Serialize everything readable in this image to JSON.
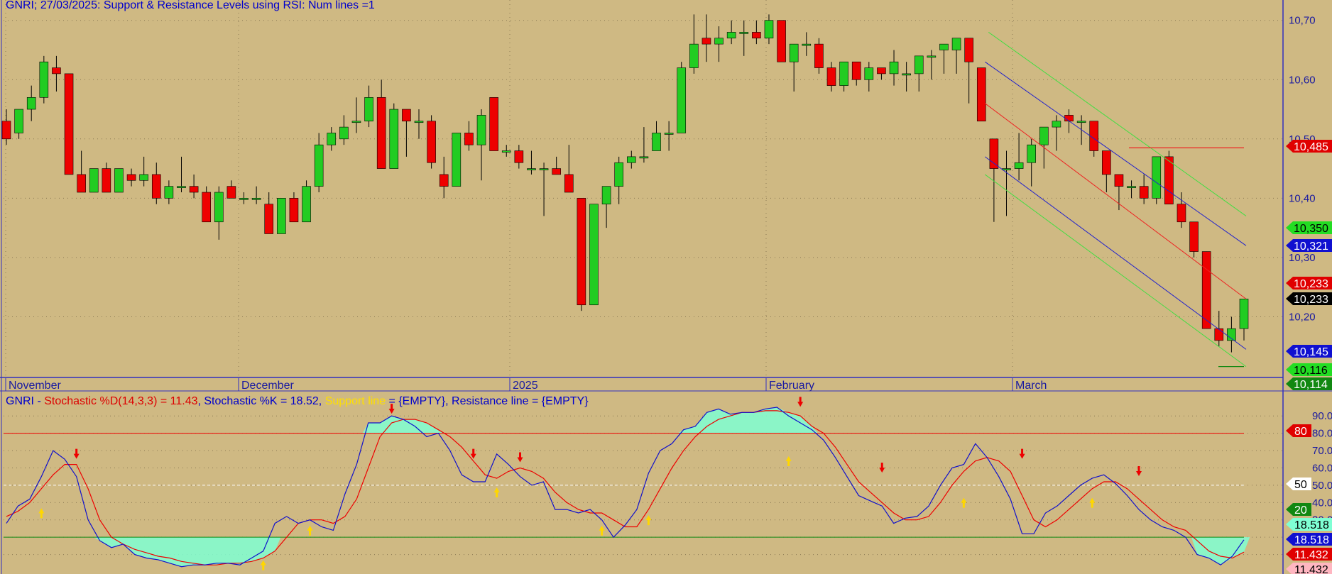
{
  "upper": {
    "title": "GNRI; 27/03/2025: Support & Resistance Levels using RSI: Num lines =1",
    "months": [
      "November",
      "December",
      "2025",
      "February",
      "March"
    ],
    "axis_ticks": [
      "10,70",
      "10,60",
      "10,50",
      "10,40",
      "10,30",
      "10,20"
    ],
    "tags": [
      {
        "text": "10,485",
        "color": "#E00000",
        "text_color": "#FFFFFF",
        "value": 10.485
      },
      {
        "text": "10,350",
        "color": "#22DD22",
        "text_color": "#000000",
        "value": 10.35
      },
      {
        "text": "10,321",
        "color": "#1010D0",
        "text_color": "#FFFFFF",
        "value": 10.321
      },
      {
        "text": "10,233",
        "color": "#E00000",
        "text_color": "#FFFFFF",
        "value": 10.233
      },
      {
        "text": "10,233",
        "color": "#000000",
        "text_color": "#FFFFFF",
        "value": 10.233
      },
      {
        "text": "10,145",
        "color": "#1010D0",
        "text_color": "#FFFFFF",
        "value": 10.145
      },
      {
        "text": "10,116",
        "color": "#22DD22",
        "text_color": "#000000",
        "value": 10.116
      },
      {
        "text": "10,114",
        "color": "#118811",
        "text_color": "#FFFFFF",
        "value": 10.114
      }
    ]
  },
  "lower": {
    "title_parts": [
      {
        "text": "GNRI - ",
        "color": "#0000CC"
      },
      {
        "text": "Stochastic %D(14,3,3) = 11.43",
        "color": "#DD0000"
      },
      {
        "text": ", Stochastic %K = 18.52, ",
        "color": "#0000CC"
      },
      {
        "text": "Support line",
        "color": "#FFE000"
      },
      {
        "text": " = {EMPTY}, Resistance line = {EMPTY}",
        "color": "#0000CC"
      }
    ],
    "axis_ticks": [
      "90.0",
      "80.0",
      "70.0",
      "60.0",
      "50.0",
      "40.0",
      "30.0"
    ],
    "tags": [
      {
        "text": "80",
        "color": "#E00000",
        "text_color": "#FFFFFF",
        "value": 80
      },
      {
        "text": "50",
        "color": "#FFFFFF",
        "text_color": "#000000",
        "value": 50
      },
      {
        "text": "20",
        "color": "#118811",
        "text_color": "#FFFFFF",
        "value": 20
      },
      {
        "text": "18.518",
        "color": "#7FFFD4",
        "text_color": "#000000",
        "value": 18.518
      },
      {
        "text": "18.518",
        "color": "#1010D0",
        "text_color": "#FFFFFF",
        "value": 18.518
      },
      {
        "text": "11.432",
        "color": "#E00000",
        "text_color": "#FFFFFF",
        "value": 11.432
      },
      {
        "text": "11.432",
        "color": "#FFB6C1",
        "text_color": "#000000",
        "value": 11.432
      }
    ]
  },
  "chart_data": [
    {
      "type": "candlestick",
      "title": "GNRI; 27/03/2025: Support & Resistance Levels using RSI: Num lines =1",
      "ylim": [
        10.1,
        10.72
      ],
      "x_labels": [
        "November",
        "December",
        "2025",
        "February",
        "March"
      ],
      "up_color": "#22CC22",
      "down_color": "#EE0000",
      "candles": [
        [
          10.53,
          10.55,
          10.49,
          10.5
        ],
        [
          10.51,
          10.55,
          10.5,
          10.55
        ],
        [
          10.55,
          10.59,
          10.53,
          10.57
        ],
        [
          10.57,
          10.64,
          10.56,
          10.63
        ],
        [
          10.62,
          10.64,
          10.58,
          10.61
        ],
        [
          10.61,
          10.61,
          10.44,
          10.44
        ],
        [
          10.44,
          10.48,
          10.41,
          10.41
        ],
        [
          10.41,
          10.45,
          10.41,
          10.45
        ],
        [
          10.45,
          10.46,
          10.41,
          10.41
        ],
        [
          10.41,
          10.45,
          10.41,
          10.45
        ],
        [
          10.44,
          10.45,
          10.42,
          10.43
        ],
        [
          10.43,
          10.47,
          10.42,
          10.44
        ],
        [
          10.44,
          10.46,
          10.39,
          10.4
        ],
        [
          10.4,
          10.43,
          10.39,
          10.42
        ],
        [
          10.42,
          10.47,
          10.41,
          10.42
        ],
        [
          10.42,
          10.44,
          10.4,
          10.41
        ],
        [
          10.41,
          10.42,
          10.36,
          10.36
        ],
        [
          10.36,
          10.42,
          10.33,
          10.41
        ],
        [
          10.42,
          10.43,
          10.4,
          10.4
        ],
        [
          10.4,
          10.41,
          10.39,
          10.4
        ],
        [
          10.4,
          10.42,
          10.39,
          10.4
        ],
        [
          10.39,
          10.41,
          10.34,
          10.34
        ],
        [
          10.34,
          10.4,
          10.34,
          10.4
        ],
        [
          10.4,
          10.41,
          10.36,
          10.36
        ],
        [
          10.36,
          10.43,
          10.36,
          10.42
        ],
        [
          10.42,
          10.51,
          10.41,
          10.49
        ],
        [
          10.49,
          10.52,
          10.48,
          10.51
        ],
        [
          10.5,
          10.54,
          10.49,
          10.52
        ],
        [
          10.53,
          10.57,
          10.51,
          10.53
        ],
        [
          10.53,
          10.59,
          10.52,
          10.57
        ],
        [
          10.57,
          10.6,
          10.45,
          10.45
        ],
        [
          10.45,
          10.56,
          10.45,
          10.55
        ],
        [
          10.55,
          10.55,
          10.47,
          10.53
        ],
        [
          10.53,
          10.55,
          10.5,
          10.53
        ],
        [
          10.53,
          10.54,
          10.45,
          10.46
        ],
        [
          10.44,
          10.47,
          10.4,
          10.42
        ],
        [
          10.42,
          10.51,
          10.42,
          10.51
        ],
        [
          10.51,
          10.53,
          10.48,
          10.49
        ],
        [
          10.49,
          10.55,
          10.43,
          10.54
        ],
        [
          10.57,
          10.57,
          10.48,
          10.48
        ],
        [
          10.48,
          10.49,
          10.47,
          10.48
        ],
        [
          10.48,
          10.49,
          10.45,
          10.46
        ],
        [
          10.45,
          10.48,
          10.44,
          10.45
        ],
        [
          10.45,
          10.46,
          10.37,
          10.45
        ],
        [
          10.45,
          10.47,
          10.44,
          10.44
        ],
        [
          10.44,
          10.49,
          10.41,
          10.41
        ],
        [
          10.4,
          10.4,
          10.21,
          10.22
        ],
        [
          10.22,
          10.39,
          10.22,
          10.39
        ],
        [
          10.39,
          10.42,
          10.35,
          10.42
        ],
        [
          10.42,
          10.47,
          10.39,
          10.46
        ],
        [
          10.46,
          10.48,
          10.45,
          10.47
        ],
        [
          10.47,
          10.52,
          10.46,
          10.47
        ],
        [
          10.48,
          10.53,
          10.48,
          10.51
        ],
        [
          10.51,
          10.53,
          10.48,
          10.51
        ],
        [
          10.51,
          10.63,
          10.51,
          10.62
        ],
        [
          10.62,
          10.71,
          10.61,
          10.66
        ],
        [
          10.67,
          10.71,
          10.63,
          10.66
        ],
        [
          10.66,
          10.69,
          10.63,
          10.67
        ],
        [
          10.67,
          10.7,
          10.66,
          10.68
        ],
        [
          10.68,
          10.7,
          10.64,
          10.68
        ],
        [
          10.68,
          10.7,
          10.66,
          10.67
        ],
        [
          10.67,
          10.71,
          10.66,
          10.7
        ],
        [
          10.7,
          10.7,
          10.63,
          10.63
        ],
        [
          10.63,
          10.66,
          10.58,
          10.66
        ],
        [
          10.66,
          10.68,
          10.64,
          10.66
        ],
        [
          10.66,
          10.67,
          10.61,
          10.62
        ],
        [
          10.62,
          10.63,
          10.58,
          10.59
        ],
        [
          10.59,
          10.63,
          10.58,
          10.63
        ],
        [
          10.63,
          10.63,
          10.59,
          10.6
        ],
        [
          10.6,
          10.63,
          10.58,
          10.62
        ],
        [
          10.62,
          10.62,
          10.6,
          10.61
        ],
        [
          10.61,
          10.65,
          10.59,
          10.63
        ],
        [
          10.61,
          10.63,
          10.58,
          10.61
        ],
        [
          10.61,
          10.64,
          10.58,
          10.64
        ],
        [
          10.64,
          10.65,
          10.6,
          10.64
        ],
        [
          10.65,
          10.66,
          10.61,
          10.66
        ],
        [
          10.65,
          10.67,
          10.61,
          10.67
        ],
        [
          10.67,
          10.67,
          10.56,
          10.63
        ],
        [
          10.62,
          10.62,
          10.53,
          10.53
        ],
        [
          10.5,
          10.5,
          10.36,
          10.45
        ],
        [
          10.45,
          10.48,
          10.37,
          10.45
        ],
        [
          10.45,
          10.51,
          10.43,
          10.46
        ],
        [
          10.46,
          10.5,
          10.42,
          10.49
        ],
        [
          10.49,
          10.5,
          10.45,
          10.52
        ],
        [
          10.52,
          10.54,
          10.48,
          10.53
        ],
        [
          10.54,
          10.55,
          10.51,
          10.53
        ],
        [
          10.53,
          10.54,
          10.49,
          10.53
        ],
        [
          10.53,
          10.53,
          10.47,
          10.48
        ],
        [
          10.48,
          10.48,
          10.41,
          10.44
        ],
        [
          10.44,
          10.44,
          10.38,
          10.42
        ],
        [
          10.42,
          10.43,
          10.4,
          10.42
        ],
        [
          10.42,
          10.44,
          10.39,
          10.4
        ],
        [
          10.4,
          10.47,
          10.39,
          10.47
        ],
        [
          10.47,
          10.48,
          10.39,
          10.39
        ],
        [
          10.39,
          10.41,
          10.35,
          10.36
        ],
        [
          10.36,
          10.36,
          10.3,
          10.31
        ],
        [
          10.31,
          10.31,
          10.18,
          10.18
        ],
        [
          10.18,
          10.21,
          10.15,
          10.16
        ],
        [
          10.16,
          10.2,
          10.14,
          10.18
        ],
        [
          10.18,
          10.23,
          10.16,
          10.23
        ]
      ]
    },
    {
      "type": "line",
      "title": "Stochastic %D(14,3,3) = 11.43, Stochastic %K = 18.52",
      "ylim": [
        0,
        95
      ],
      "series": [
        {
          "name": "Stochastic %K",
          "color": "#1010CC",
          "values": [
            28,
            38,
            42,
            55,
            70,
            65,
            55,
            30,
            18,
            14,
            16,
            10,
            8,
            7,
            5,
            3,
            4,
            4,
            5,
            5,
            4,
            8,
            12,
            28,
            32,
            28,
            30,
            26,
            24,
            45,
            62,
            86,
            86,
            90,
            88,
            84,
            78,
            80,
            70,
            56,
            52,
            52,
            68,
            62,
            55,
            50,
            52,
            36,
            36,
            34,
            36,
            30,
            20,
            27,
            36,
            57,
            70,
            74,
            82,
            84,
            92,
            94,
            91,
            92,
            92,
            94,
            95,
            90,
            86,
            82,
            76,
            66,
            55,
            44,
            41,
            38,
            28,
            31,
            32,
            38,
            50,
            60,
            62,
            74,
            66,
            55,
            42,
            22,
            22,
            34,
            38,
            44,
            50,
            54,
            56,
            51,
            44,
            36,
            30,
            26,
            24,
            20,
            10,
            8,
            4,
            9,
            18.52
          ]
        },
        {
          "name": "Stochastic %D",
          "color": "#EE0000",
          "values": [
            32,
            35,
            40,
            48,
            56,
            62,
            62,
            48,
            30,
            20,
            16,
            13,
            11,
            9,
            8,
            6,
            5,
            4,
            4,
            5,
            5,
            6,
            8,
            12,
            20,
            28,
            30,
            30,
            28,
            32,
            42,
            60,
            78,
            86,
            88,
            88,
            86,
            82,
            78,
            72,
            64,
            56,
            54,
            58,
            60,
            58,
            54,
            46,
            40,
            36,
            34,
            34,
            30,
            26,
            26,
            36,
            48,
            60,
            70,
            78,
            84,
            88,
            90,
            92,
            92,
            93,
            93,
            92,
            90,
            84,
            80,
            72,
            62,
            52,
            46,
            40,
            34,
            30,
            30,
            32,
            40,
            50,
            58,
            64,
            66,
            64,
            58,
            44,
            30,
            26,
            30,
            36,
            42,
            48,
            52,
            52,
            48,
            42,
            36,
            30,
            26,
            24,
            18,
            12,
            9,
            8,
            11.43
          ]
        }
      ],
      "reference_lines": [
        {
          "value": 80,
          "color": "#EE0000"
        },
        {
          "value": 50,
          "color": "#FFFFFF"
        },
        {
          "value": 20,
          "color": "#118811"
        }
      ]
    }
  ]
}
